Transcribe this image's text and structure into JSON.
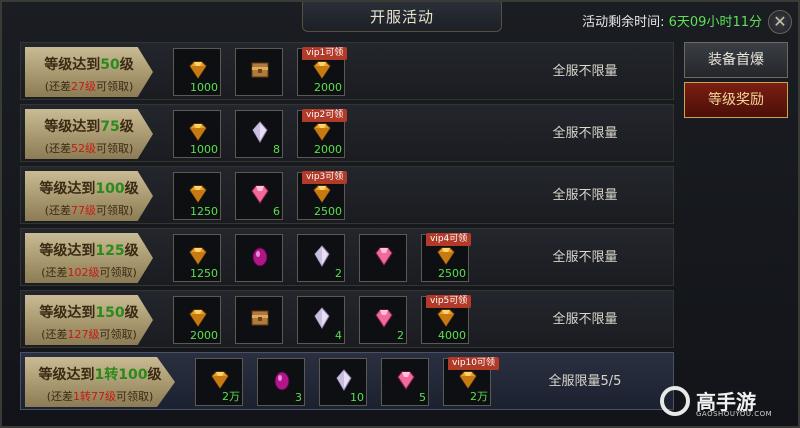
{
  "header": {
    "title": "开服活动",
    "timer_label": "活动剩余时间:",
    "timer_value": "6天09小时11分",
    "close_glyph": "✕"
  },
  "tabs": [
    {
      "label": "装备首爆",
      "active": false
    },
    {
      "label": "等级奖励",
      "active": true
    }
  ],
  "rows": [
    {
      "label_pre": "等级达到",
      "level": "50",
      "label_post": "级",
      "hint_pre": "(还差",
      "hint_num": "27级",
      "hint_post": "可领取)",
      "limit": "全服不限量",
      "items": [
        {
          "icon": "gold-gem",
          "count": "1000"
        },
        {
          "icon": "bronze-box",
          "count": ""
        },
        {
          "icon": "gold-gem",
          "count": "2000",
          "vip": "vip1可领"
        }
      ]
    },
    {
      "label_pre": "等级达到",
      "level": "75",
      "label_post": "级",
      "hint_pre": "(还差",
      "hint_num": "52级",
      "hint_post": "可领取)",
      "limit": "全服不限量",
      "items": [
        {
          "icon": "gold-gem",
          "count": "1000"
        },
        {
          "icon": "white-crystal",
          "count": "8"
        },
        {
          "icon": "gold-gem",
          "count": "2000",
          "vip": "vip2可领"
        }
      ]
    },
    {
      "label_pre": "等级达到",
      "level": "100",
      "label_post": "级",
      "hint_pre": "(还差",
      "hint_num": "77级",
      "hint_post": "可领取)",
      "limit": "全服不限量",
      "items": [
        {
          "icon": "gold-gem",
          "count": "1250"
        },
        {
          "icon": "pink-gem",
          "count": "6"
        },
        {
          "icon": "gold-gem",
          "count": "2500",
          "vip": "vip3可领"
        }
      ]
    },
    {
      "label_pre": "等级达到",
      "level": "125",
      "label_post": "级",
      "hint_pre": "(还差",
      "hint_num": "102级",
      "hint_post": "可领取)",
      "limit": "全服不限量",
      "items": [
        {
          "icon": "gold-gem",
          "count": "1250"
        },
        {
          "icon": "purple-egg",
          "count": ""
        },
        {
          "icon": "white-crystal",
          "count": "2"
        },
        {
          "icon": "pink-gem",
          "count": ""
        },
        {
          "icon": "gold-gem",
          "count": "2500",
          "vip": "vip4可领"
        }
      ]
    },
    {
      "label_pre": "等级达到",
      "level": "150",
      "label_post": "级",
      "hint_pre": "(还差",
      "hint_num": "127级",
      "hint_post": "可领取)",
      "limit": "全服不限量",
      "items": [
        {
          "icon": "gold-gem",
          "count": "2000"
        },
        {
          "icon": "bronze-box",
          "count": ""
        },
        {
          "icon": "white-crystal",
          "count": "4"
        },
        {
          "icon": "pink-gem",
          "count": "2"
        },
        {
          "icon": "gold-gem",
          "count": "4000",
          "vip": "vip5可领"
        }
      ]
    },
    {
      "label_pre": "等级达到",
      "level": "1转100",
      "label_post": "级",
      "hint_pre": "(还差",
      "hint_num": "1转77级",
      "hint_post": "可领取)",
      "limit": "全服限量5/5",
      "items": [
        {
          "icon": "gold-gem",
          "count": "2万"
        },
        {
          "icon": "purple-egg",
          "count": "3"
        },
        {
          "icon": "white-crystal",
          "count": "10"
        },
        {
          "icon": "pink-gem",
          "count": "5"
        },
        {
          "icon": "gold-gem",
          "count": "2万",
          "vip": "vip10可领"
        }
      ]
    }
  ],
  "watermark": {
    "name": "高手游",
    "url": "GAOSHOUYOU.COM"
  }
}
